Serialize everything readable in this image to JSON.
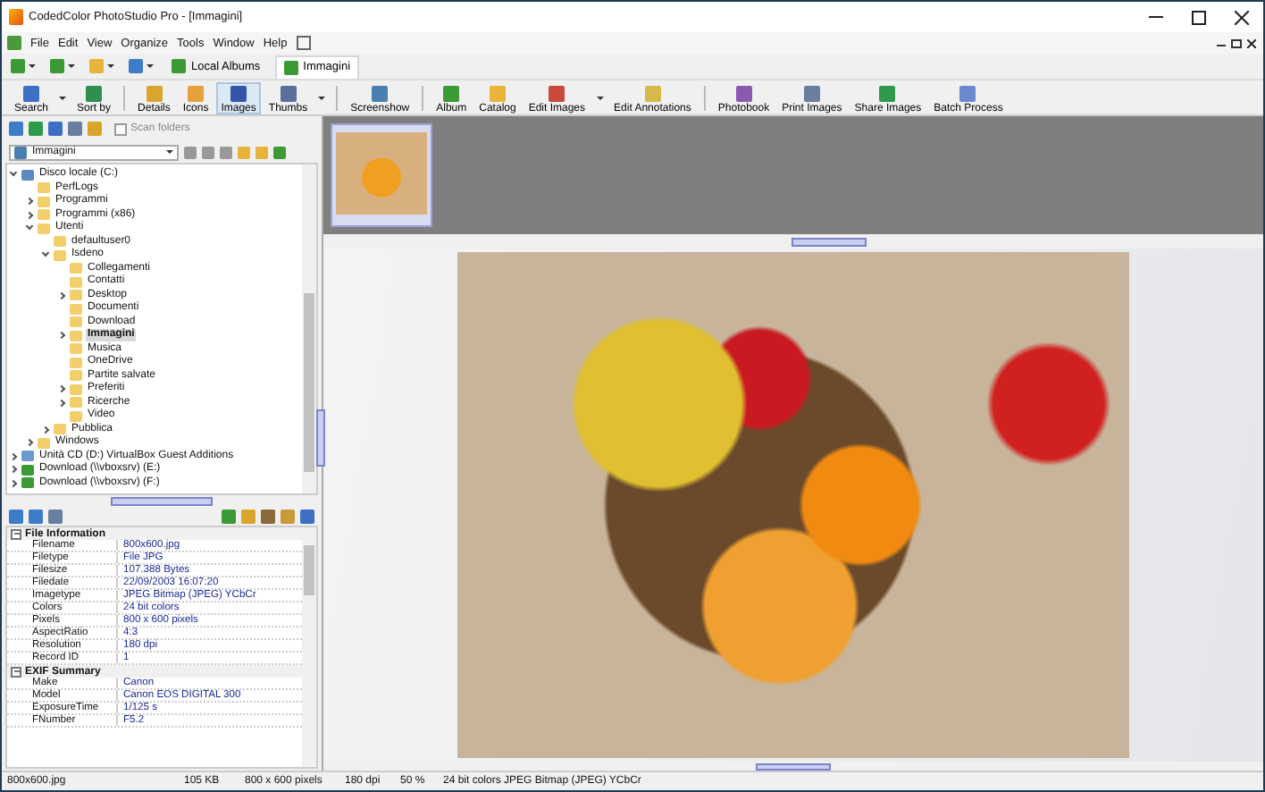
{
  "window": {
    "title": "CodedColor PhotoStudio Pro - [Immagini]"
  },
  "menu": [
    "File",
    "Edit",
    "View",
    "Organize",
    "Tools",
    "Window",
    "Help"
  ],
  "tabs": [
    {
      "label": "Local Albums",
      "selected": false
    },
    {
      "label": "Immagini",
      "selected": true
    }
  ],
  "toolbar": [
    {
      "label": "Search",
      "selected": false,
      "dropdown": true
    },
    {
      "label": "Sort by",
      "selected": false,
      "dropdown": false
    },
    {
      "label": "Details",
      "selected": false,
      "dropdown": false
    },
    {
      "label": "Icons",
      "selected": false,
      "dropdown": false
    },
    {
      "label": "Images",
      "selected": true,
      "dropdown": false
    },
    {
      "label": "Thumbs",
      "selected": false,
      "dropdown": true
    },
    {
      "label": "Screenshow",
      "selected": false,
      "dropdown": false
    },
    {
      "label": "Album",
      "selected": false,
      "dropdown": false
    },
    {
      "label": "Catalog",
      "selected": false,
      "dropdown": false
    },
    {
      "label": "Edit Images",
      "selected": false,
      "dropdown": true
    },
    {
      "label": "Edit Annotations",
      "selected": false,
      "dropdown": false
    },
    {
      "label": "Photobook",
      "selected": false,
      "dropdown": false
    },
    {
      "label": "Print Images",
      "selected": false,
      "dropdown": false
    },
    {
      "label": "Share Images",
      "selected": false,
      "dropdown": false
    },
    {
      "label": "Batch Process",
      "selected": false,
      "dropdown": false
    }
  ],
  "scan_folders": {
    "label": "Scan folders",
    "checked": false
  },
  "folder_combo": {
    "value": "Immagini"
  },
  "tree": [
    {
      "label": "Disco locale (C:)",
      "kind": "drive",
      "expanded": true,
      "selected": false,
      "children": [
        {
          "label": "PerfLogs",
          "kind": "folder",
          "selected": false
        },
        {
          "label": "Programmi",
          "kind": "folder",
          "expanded": false,
          "selected": false
        },
        {
          "label": "Programmi (x86)",
          "kind": "folder",
          "expanded": false,
          "selected": false
        },
        {
          "label": "Utenti",
          "kind": "folder",
          "expanded": true,
          "selected": false,
          "children": [
            {
              "label": "defaultuser0",
              "kind": "folder",
              "selected": false
            },
            {
              "label": "Isdeno",
              "kind": "folder",
              "expanded": true,
              "selected": false,
              "children": [
                {
                  "label": "Collegamenti",
                  "kind": "folder",
                  "selected": false
                },
                {
                  "label": "Contatti",
                  "kind": "folder",
                  "selected": false
                },
                {
                  "label": "Desktop",
                  "kind": "folder",
                  "expanded": false,
                  "selected": false
                },
                {
                  "label": "Documenti",
                  "kind": "folder",
                  "selected": false
                },
                {
                  "label": "Download",
                  "kind": "folder",
                  "selected": false
                },
                {
                  "label": "Immagini",
                  "kind": "folder",
                  "expanded": false,
                  "selected": true
                },
                {
                  "label": "Musica",
                  "kind": "folder",
                  "selected": false
                },
                {
                  "label": "OneDrive",
                  "kind": "folder",
                  "selected": false
                },
                {
                  "label": "Partite salvate",
                  "kind": "folder",
                  "selected": false
                },
                {
                  "label": "Preferiti",
                  "kind": "folder",
                  "expanded": false,
                  "selected": false
                },
                {
                  "label": "Ricerche",
                  "kind": "folder",
                  "expanded": false,
                  "selected": false
                },
                {
                  "label": "Video",
                  "kind": "folder",
                  "selected": false
                }
              ]
            },
            {
              "label": "Pubblica",
              "kind": "folder",
              "expanded": false,
              "selected": false
            }
          ]
        },
        {
          "label": "Windows",
          "kind": "folder",
          "expanded": false,
          "selected": false
        }
      ]
    },
    {
      "label": "Unità CD (D:) VirtualBox Guest Additions",
      "kind": "cd",
      "expanded": false,
      "selected": false
    },
    {
      "label": "Download (\\\\vboxsrv) (E:)",
      "kind": "network",
      "expanded": false,
      "selected": false
    },
    {
      "label": "Download (\\\\vboxsrv) (F:)",
      "kind": "network",
      "expanded": false,
      "selected": false
    }
  ],
  "info_sections": [
    {
      "title": "File Information",
      "expanded": true,
      "rows": [
        {
          "name": "Filename",
          "value": "800x600.jpg"
        },
        {
          "name": "Filetype",
          "value": "File JPG"
        },
        {
          "name": "Filesize",
          "value": "107.388 Bytes"
        },
        {
          "name": "Filedate",
          "value": "22/09/2003 16:07:20"
        },
        {
          "name": "Imagetype",
          "value": "JPEG Bitmap (JPEG) YCbCr"
        },
        {
          "name": "Colors",
          "value": "24 bit colors"
        },
        {
          "name": "Pixels",
          "value": "800 x 600 pixels"
        },
        {
          "name": "AspectRatio",
          "value": "4:3"
        },
        {
          "name": "Resolution",
          "value": "180 dpi"
        },
        {
          "name": "Record ID",
          "value": "1"
        }
      ]
    },
    {
      "title": "EXIF Summary",
      "expanded": true,
      "rows": [
        {
          "name": "Make",
          "value": "Canon"
        },
        {
          "name": "Model",
          "value": "Canon EOS DIGITAL 300"
        },
        {
          "name": "ExposureTime",
          "value": "1/125 s"
        },
        {
          "name": "FNumber",
          "value": "F5.2"
        }
      ]
    }
  ],
  "status_bar": [
    "800x600.jpg",
    "105 KB",
    "800 x 600 pixels",
    "180 dpi",
    "50 %",
    "24 bit colors JPEG Bitmap (JPEG) YCbCr"
  ]
}
